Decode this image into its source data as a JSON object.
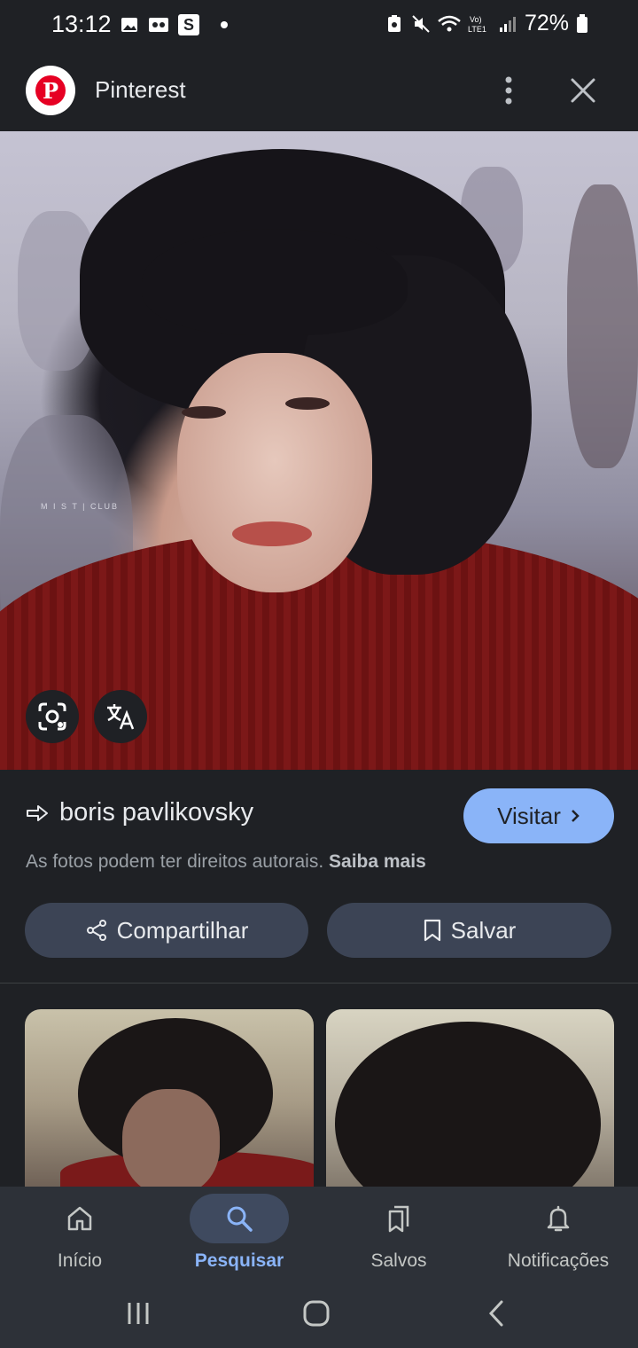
{
  "status_bar": {
    "time": "13:12",
    "s_icon_text": "S",
    "battery": "72%"
  },
  "app_bar": {
    "title": "Pinterest",
    "logo_letter": "P"
  },
  "hero": {
    "watermark": "M I S T | CLUB"
  },
  "result": {
    "title": "boris pavlikovsky",
    "visit_label": "Visitar",
    "copyright_text": "As fotos podem ter direitos autorais.",
    "learn_more": "Saiba mais"
  },
  "actions": {
    "share_label": "Compartilhar",
    "save_label": "Salvar"
  },
  "bottom_nav": {
    "items": [
      {
        "label": "Início",
        "icon": "home-icon"
      },
      {
        "label": "Pesquisar",
        "icon": "search-icon"
      },
      {
        "label": "Salvos",
        "icon": "bookmarks-icon"
      },
      {
        "label": "Notificações",
        "icon": "bell-icon"
      }
    ],
    "active_index": 1
  },
  "colors": {
    "background": "#1f2125",
    "accent": "#8ab4f8",
    "pill": "#3c4455",
    "pinterest_red": "#e60023"
  }
}
